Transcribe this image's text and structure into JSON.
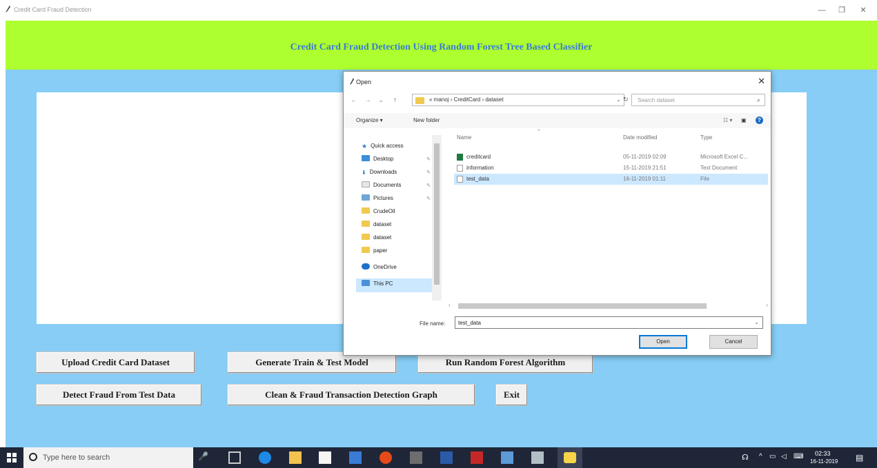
{
  "window": {
    "title": "Credit Card Fraud Detection",
    "minimize": "—",
    "maximize": "❐",
    "close": "✕"
  },
  "banner": {
    "title": "Credit Card Fraud Detection Using Random Forest Tree Based Classifier"
  },
  "buttons": {
    "upload": "Upload Credit Card Dataset",
    "generate": "Generate Train & Test Model",
    "run": "Run Random Forest Algorithm",
    "detect": "Detect Fraud From Test Data",
    "graph": "Clean & Fraud Transaction Detection Graph",
    "exit": "Exit"
  },
  "dialog": {
    "title": "Open",
    "close": "✕",
    "breadcrumb": "« manoj › CreditCard › dataset",
    "search_placeholder": "Search dataset",
    "toolbar": {
      "organize": "Organize ▾",
      "new_folder": "New folder"
    },
    "nav": {
      "quick_access": "Quick access",
      "items": [
        "Desktop",
        "Downloads",
        "Documents",
        "Pictures",
        "CrudeOil",
        "dataset",
        "dataset",
        "paper"
      ],
      "onedrive": "OneDrive",
      "this_pc": "This PC"
    },
    "columns": {
      "name": "Name",
      "date": "Date modified",
      "type": "Type"
    },
    "files": [
      {
        "name": "creditcard",
        "date": "05-11-2019 02:09",
        "type": "Microsoft Excel C..."
      },
      {
        "name": "information",
        "date": "15-11-2019 21:51",
        "type": "Text Document"
      },
      {
        "name": "test_data",
        "date": "16-11-2019 01:11",
        "type": "File"
      }
    ],
    "file_name_label": "File name:",
    "file_name_value": "test_data",
    "open_button": "Open",
    "cancel_button": "Cancel"
  },
  "taskbar": {
    "search_placeholder": "Type here to search",
    "time": "02:33",
    "date": "16-11-2019"
  },
  "colors": {
    "banner": "#adff2f",
    "workspace": "#87cdf5",
    "title_text": "#3a7bd5",
    "selection": "#cce8ff"
  }
}
